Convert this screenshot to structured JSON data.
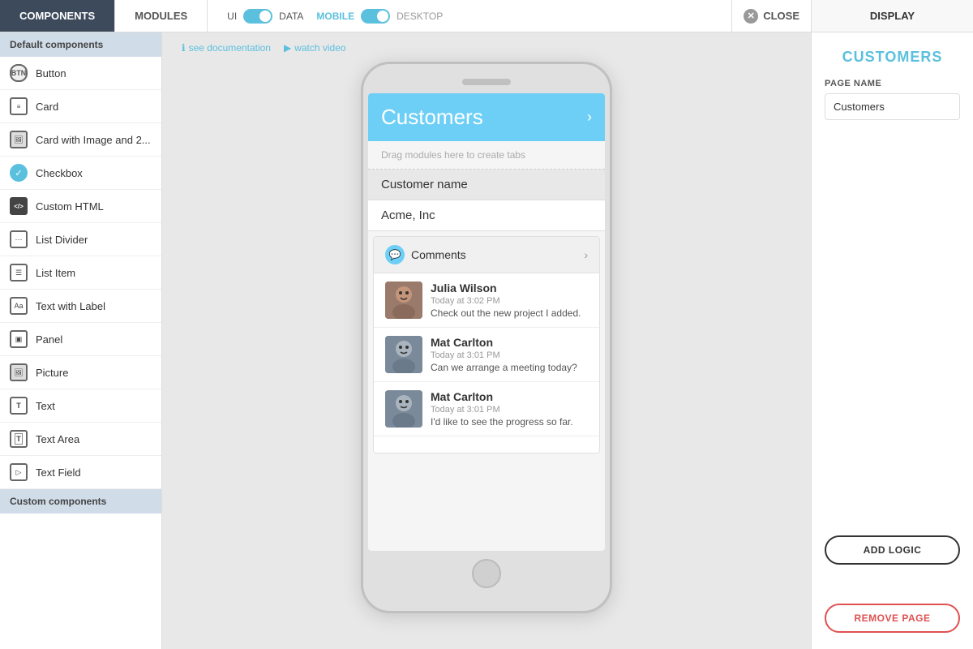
{
  "topBar": {
    "tab1": "COMPONENTS",
    "tab2": "MODULES",
    "ui_label": "UI",
    "data_label": "DATA",
    "mobile_label": "MOBILE",
    "desktop_label": "DESKTOP",
    "close_label": "CLOSE",
    "display_label": "DISPLAY"
  },
  "canvas": {
    "doc_link": "see documentation",
    "video_link": "watch video"
  },
  "sidebar": {
    "section_default": "Default components",
    "section_custom": "Custom components",
    "items": [
      {
        "label": "Button",
        "icon": "btn"
      },
      {
        "label": "Card",
        "icon": "card"
      },
      {
        "label": "Card with Image and 2...",
        "icon": "img"
      },
      {
        "label": "Checkbox",
        "icon": "chk"
      },
      {
        "label": "Custom HTML",
        "icon": "htm"
      },
      {
        "label": "List Divider",
        "icon": "div"
      },
      {
        "label": "List Item",
        "icon": "lst"
      },
      {
        "label": "Text with Label",
        "icon": "txl"
      },
      {
        "label": "Panel",
        "icon": "pnl"
      },
      {
        "label": "Picture",
        "icon": "pic"
      },
      {
        "label": "Text",
        "icon": "txt"
      },
      {
        "label": "Text Area",
        "icon": "ta"
      },
      {
        "label": "Text Field",
        "icon": "tf"
      }
    ]
  },
  "phone": {
    "header_title": "Customers",
    "tabs_placeholder": "Drag modules here to create tabs",
    "customer_name_header": "Customer name",
    "customer_name_value": "Acme, Inc",
    "comments_title": "Comments",
    "comments": [
      {
        "name": "Julia Wilson",
        "time": "Today at 3:02 PM",
        "text": "Check out the new project I added.",
        "avatar_color": "#9a7a6a"
      },
      {
        "name": "Mat Carlton",
        "time": "Today at 3:01 PM",
        "text": "Can we arrange a meeting today?",
        "avatar_color": "#7a8a9a"
      },
      {
        "name": "Mat Carlton",
        "time": "Today at 3:01 PM",
        "text": "I'd like to see the progress so far.",
        "avatar_color": "#7a8a9a"
      }
    ]
  },
  "rightPanel": {
    "title": "CUSTOMERS",
    "page_name_label": "PAGE NAME",
    "page_name_value": "Customers",
    "add_logic_label": "ADD LOGIC",
    "remove_page_label": "REMOVE PAGE"
  }
}
